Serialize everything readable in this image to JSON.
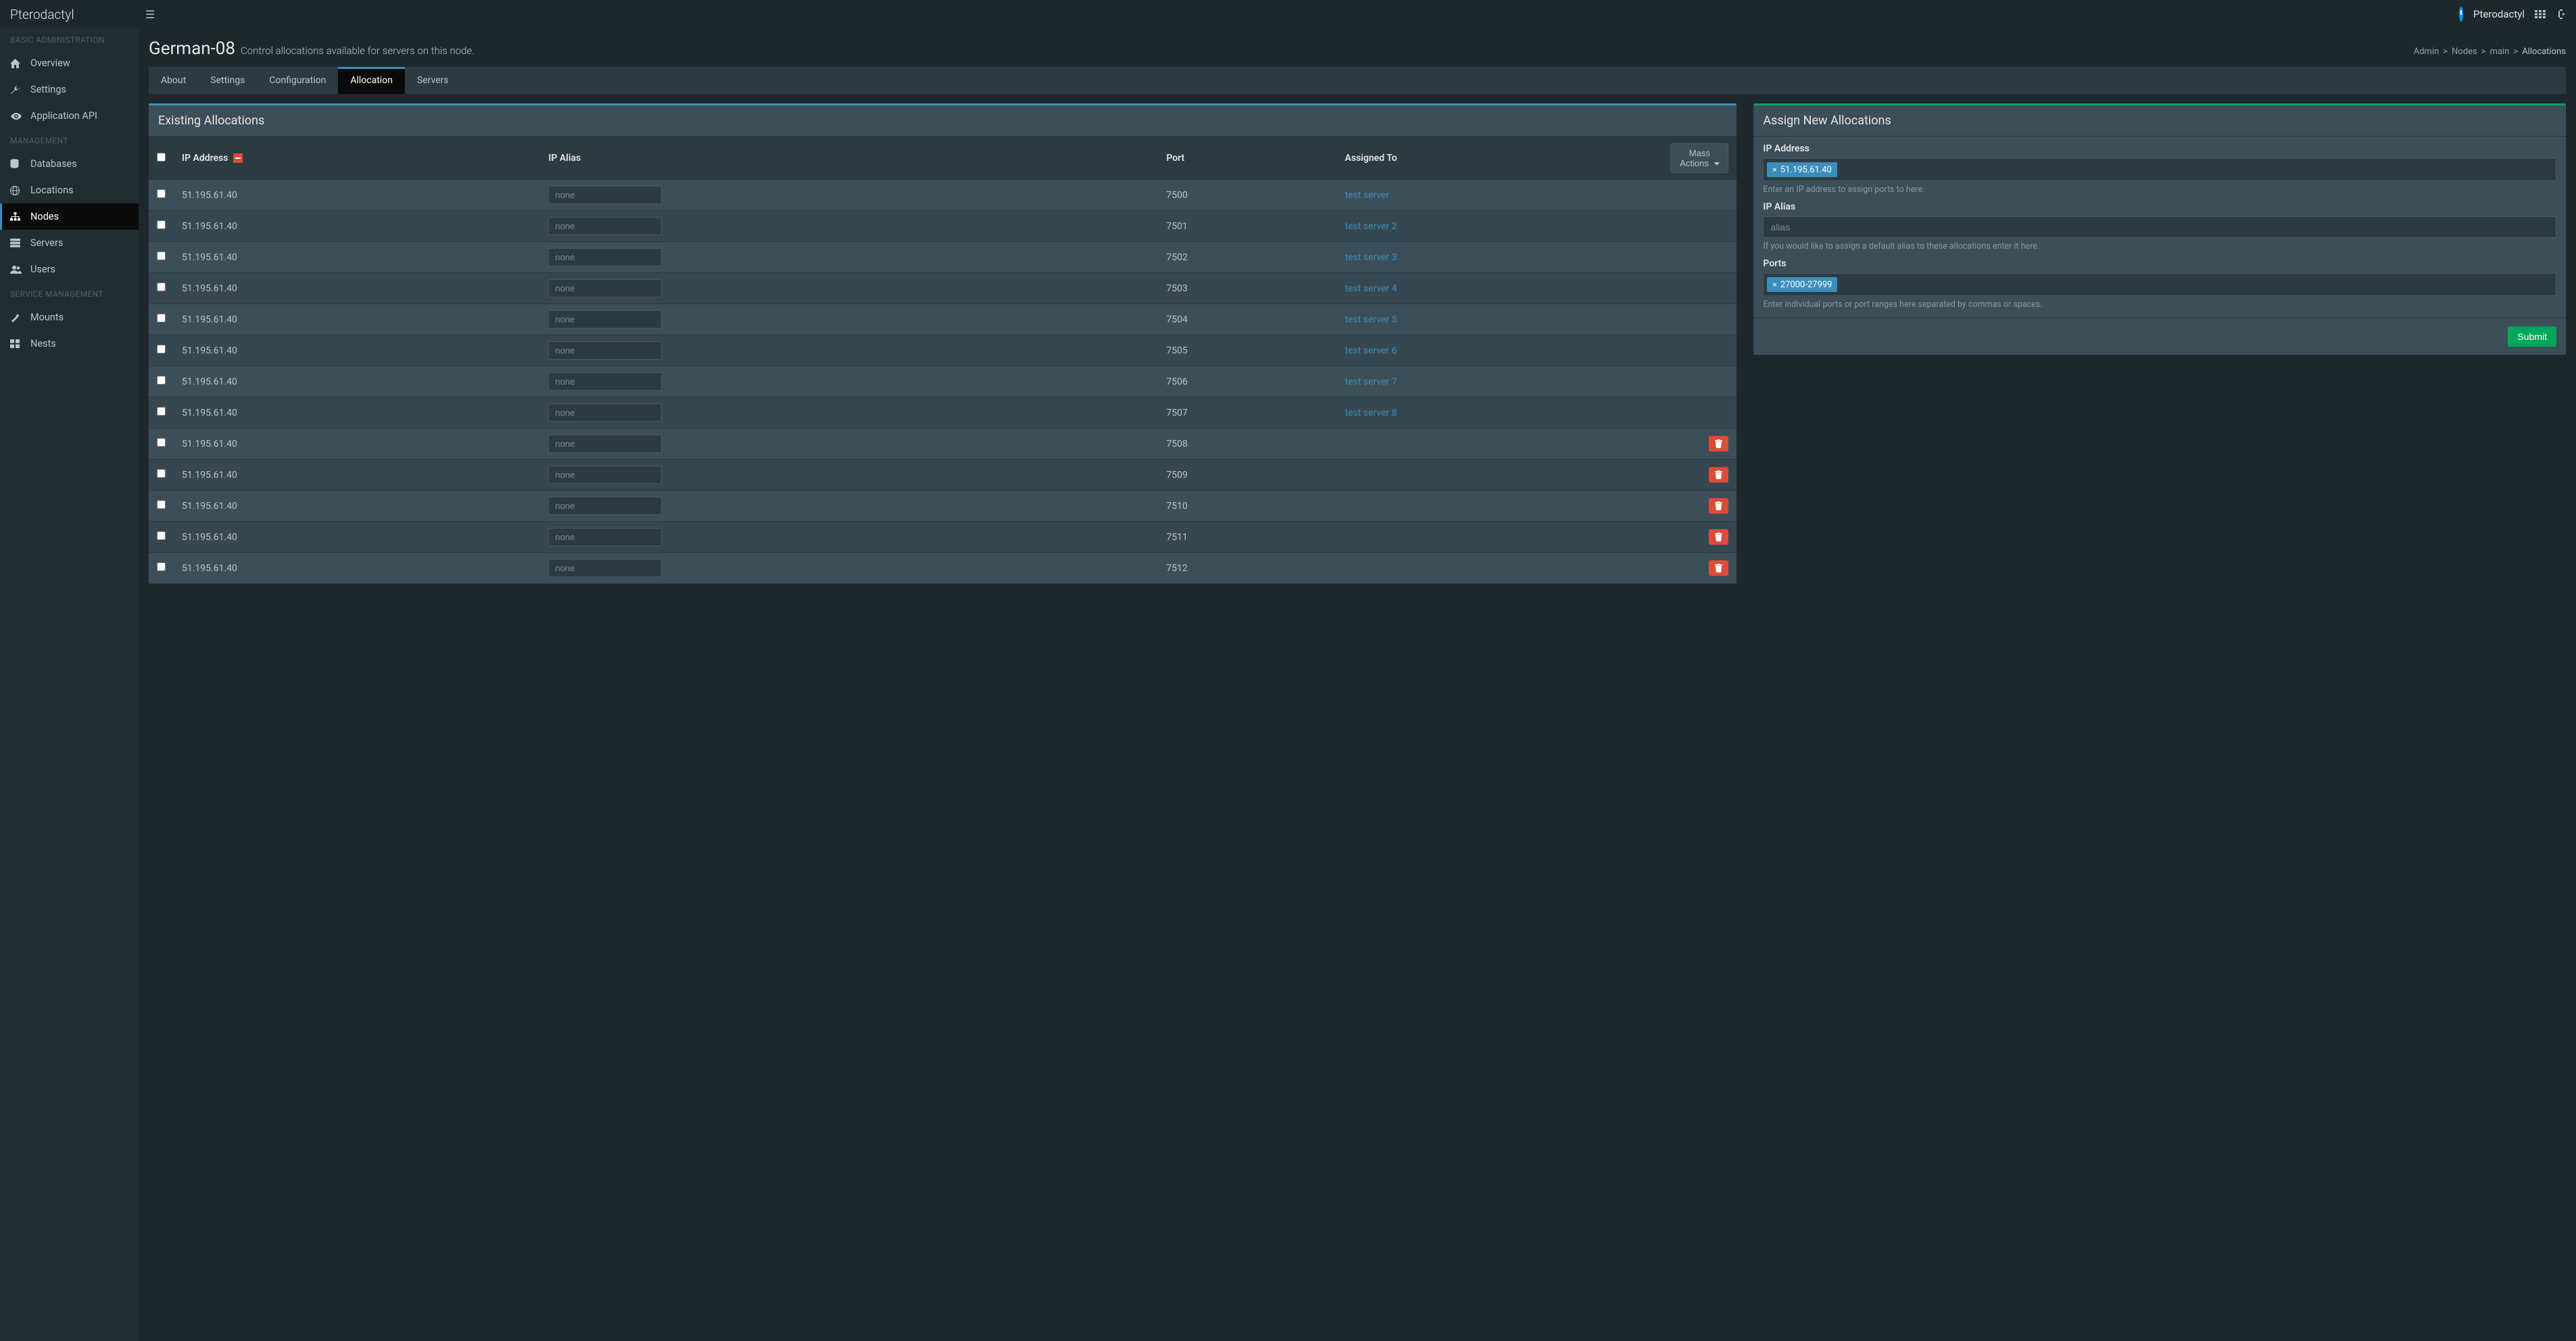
{
  "app_name": "Pterodactyl",
  "user_name": "Pterodactyl",
  "sidebar": {
    "sections": [
      {
        "title": "BASIC ADMINISTRATION",
        "items": [
          {
            "label": "Overview",
            "icon": "home"
          },
          {
            "label": "Settings",
            "icon": "wrench"
          },
          {
            "label": "Application API",
            "icon": "eye"
          }
        ]
      },
      {
        "title": "MANAGEMENT",
        "items": [
          {
            "label": "Databases",
            "icon": "database"
          },
          {
            "label": "Locations",
            "icon": "globe"
          },
          {
            "label": "Nodes",
            "icon": "sitemap",
            "active": true
          },
          {
            "label": "Servers",
            "icon": "server"
          },
          {
            "label": "Users",
            "icon": "users"
          }
        ]
      },
      {
        "title": "SERVICE MANAGEMENT",
        "items": [
          {
            "label": "Mounts",
            "icon": "magic"
          },
          {
            "label": "Nests",
            "icon": "th-large"
          }
        ]
      }
    ]
  },
  "page": {
    "title": "German-08",
    "subtitle": "Control allocations available for servers on this node."
  },
  "breadcrumb": [
    "Admin",
    "Nodes",
    "main",
    "Allocations"
  ],
  "tabs": [
    "About",
    "Settings",
    "Configuration",
    "Allocation",
    "Servers"
  ],
  "active_tab": "Allocation",
  "existing": {
    "title": "Existing Allocations",
    "headers": {
      "ip": "IP Address",
      "alias": "IP Alias",
      "port": "Port",
      "assigned": "Assigned To"
    },
    "mass_actions_label": "Mass Actions",
    "alias_placeholder": "none",
    "rows": [
      {
        "ip": "51.195.61.40",
        "port": "7500",
        "server": "test server"
      },
      {
        "ip": "51.195.61.40",
        "port": "7501",
        "server": "test server 2"
      },
      {
        "ip": "51.195.61.40",
        "port": "7502",
        "server": "test server 3"
      },
      {
        "ip": "51.195.61.40",
        "port": "7503",
        "server": "test server 4"
      },
      {
        "ip": "51.195.61.40",
        "port": "7504",
        "server": "test server 5"
      },
      {
        "ip": "51.195.61.40",
        "port": "7505",
        "server": "test server 6"
      },
      {
        "ip": "51.195.61.40",
        "port": "7506",
        "server": "test server 7"
      },
      {
        "ip": "51.195.61.40",
        "port": "7507",
        "server": "test server 8"
      },
      {
        "ip": "51.195.61.40",
        "port": "7508",
        "server": null
      },
      {
        "ip": "51.195.61.40",
        "port": "7509",
        "server": null
      },
      {
        "ip": "51.195.61.40",
        "port": "7510",
        "server": null
      },
      {
        "ip": "51.195.61.40",
        "port": "7511",
        "server": null
      },
      {
        "ip": "51.195.61.40",
        "port": "7512",
        "server": null
      }
    ]
  },
  "assign": {
    "title": "Assign New Allocations",
    "ip_label": "IP Address",
    "ip_tag": "51.195.61.40",
    "ip_help": "Enter an IP address to assign ports to here.",
    "alias_label": "IP Alias",
    "alias_placeholder": "alias",
    "alias_help": "If you would like to assign a default alias to these allocations enter it here.",
    "ports_label": "Ports",
    "ports_tag": "27000-27999",
    "ports_help": "Enter individual ports or port ranges here separated by commas or spaces.",
    "submit": "Submit"
  },
  "icons": {
    "home": "🏠",
    "wrench": "🔧",
    "eye": "👁",
    "database": "🗄",
    "globe": "🌐",
    "sitemap": "╬",
    "server": "☰",
    "users": "👥",
    "magic": "✨",
    "th-large": "▦",
    "trash": "🗑"
  }
}
